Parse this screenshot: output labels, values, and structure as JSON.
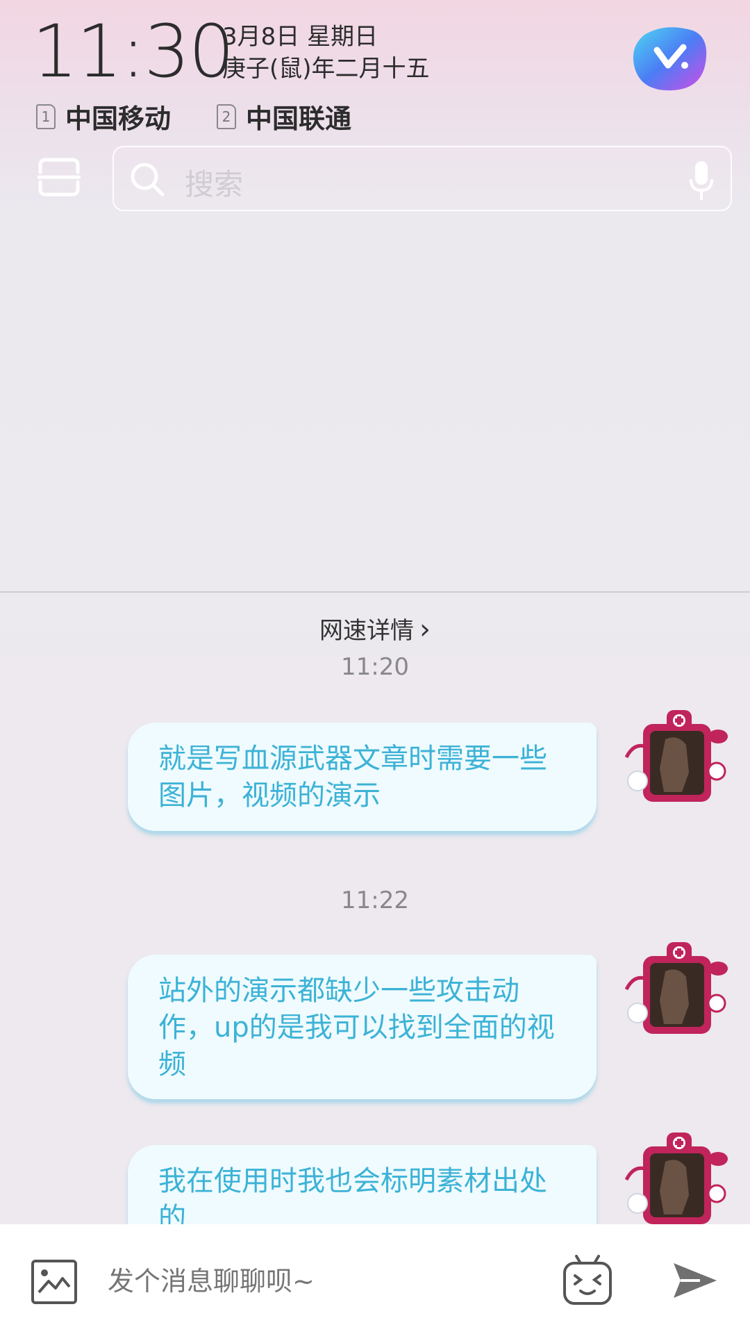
{
  "status": {
    "time": "11:30",
    "date_line1": "3月8日 星期日",
    "date_line2": "庚子(鼠)年二月十五",
    "sim1_num": "1",
    "sim1_carrier": "中国移动",
    "sim2_num": "2",
    "sim2_carrier": "中国联通"
  },
  "shade": {
    "search_placeholder": "搜索",
    "network_speed_label": "网速详情"
  },
  "chat": {
    "messages": [
      {
        "timestamp": "11:20",
        "text": "就是写血源武器文章时需要一些图片，视频的演示"
      },
      {
        "timestamp": "11:22",
        "text": "站外的演示都缺少一些攻击动作，up的是我可以找到全面的视频"
      },
      {
        "timestamp": "",
        "text": "我在使用时我也会标明素材出处的"
      }
    ]
  },
  "input_bar": {
    "placeholder": "发个消息聊聊呗~",
    "icons": [
      "image-icon",
      "emoji-icon",
      "send-icon"
    ]
  },
  "colors": {
    "bubble_bg": "#effbfe",
    "bubble_text": "#3cb2d6",
    "avatar_frame": "#c0245a"
  }
}
